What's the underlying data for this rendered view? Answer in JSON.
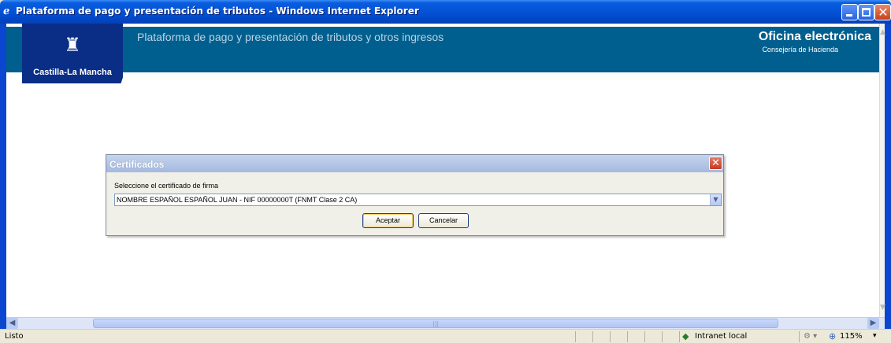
{
  "window": {
    "title": "Plataforma de pago y presentación de tributos - Windows Internet Explorer",
    "icon": "ie-logo-icon"
  },
  "banner": {
    "logo_text": "Castilla-La Mancha",
    "title": "Plataforma de pago y presentación de tributos y otros ingresos",
    "office_name": "Oficina electrónica",
    "office_sub": "Consejería de Hacienda"
  },
  "dialog": {
    "title": "Certificados",
    "label": "Seleccione el certificado de firma",
    "selected_certificate": "NOMBRE ESPAÑOL ESPAÑOL JUAN - NIF 00000000T (FNMT Clase 2 CA)",
    "accept_label": "Aceptar",
    "cancel_label": "Cancelar"
  },
  "status": {
    "text": "Listo",
    "zone": "Intranet local",
    "zoom": "115%"
  },
  "colors": {
    "banner": "#005f8e",
    "logo": "#0a2d86",
    "titlebar": "#0553d6"
  }
}
